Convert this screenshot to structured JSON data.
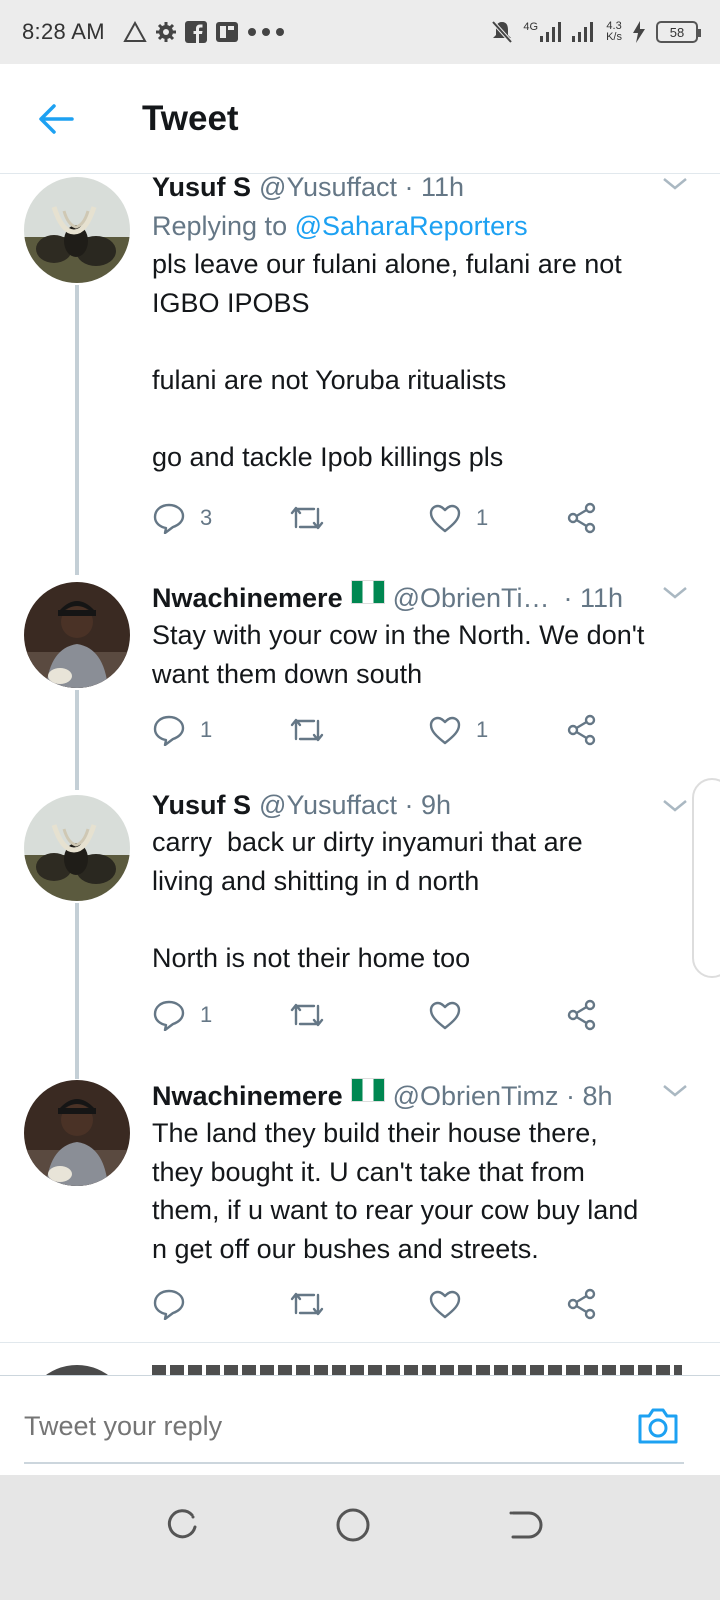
{
  "status_bar": {
    "time": "8:28 AM",
    "network_label": "4G",
    "speed_value": "4.3",
    "speed_unit": "K/s",
    "battery": "58"
  },
  "header": {
    "title": "Tweet"
  },
  "tweets": [
    {
      "name": "Yusuf S",
      "handle": "@Yusuffact · 11h",
      "replying_prefix": "Replying to",
      "replying_handle": "@SaharaReporters",
      "body": "pls leave our fulani alone, fulani are not\nIGBO IPOBS\n\nfulani are not Yoruba ritualists\n\ngo and tackle Ipob killings pls",
      "reply_count": "3",
      "like_count": "1"
    },
    {
      "name": "Nwachinemere",
      "handle": "@ObrienTi…",
      "time": "· 11h",
      "body": "Stay with your cow in the North. We don't\nwant them down south",
      "reply_count": "1",
      "like_count": "1"
    },
    {
      "name": "Yusuf S",
      "handle": "@Yusuffact · 9h",
      "body": "carry  back ur dirty inyamuri that are\nliving and shitting in d north\n\nNorth is not their home too",
      "reply_count": "1",
      "like_count": ""
    },
    {
      "name": "Nwachinemere",
      "handle": "@ObrienTimz · 8h",
      "body": "The land they build their house there,\nthey bought it. U can't take that from\nthem, if u want to rear your cow buy land\nn get off our bushes and streets.",
      "reply_count": "",
      "like_count": ""
    }
  ],
  "reply_bar": {
    "placeholder": "Tweet your reply"
  },
  "colors": {
    "accent": "#1da1f2",
    "secondary_text": "#657786",
    "thread_line": "#c4cfd6"
  }
}
